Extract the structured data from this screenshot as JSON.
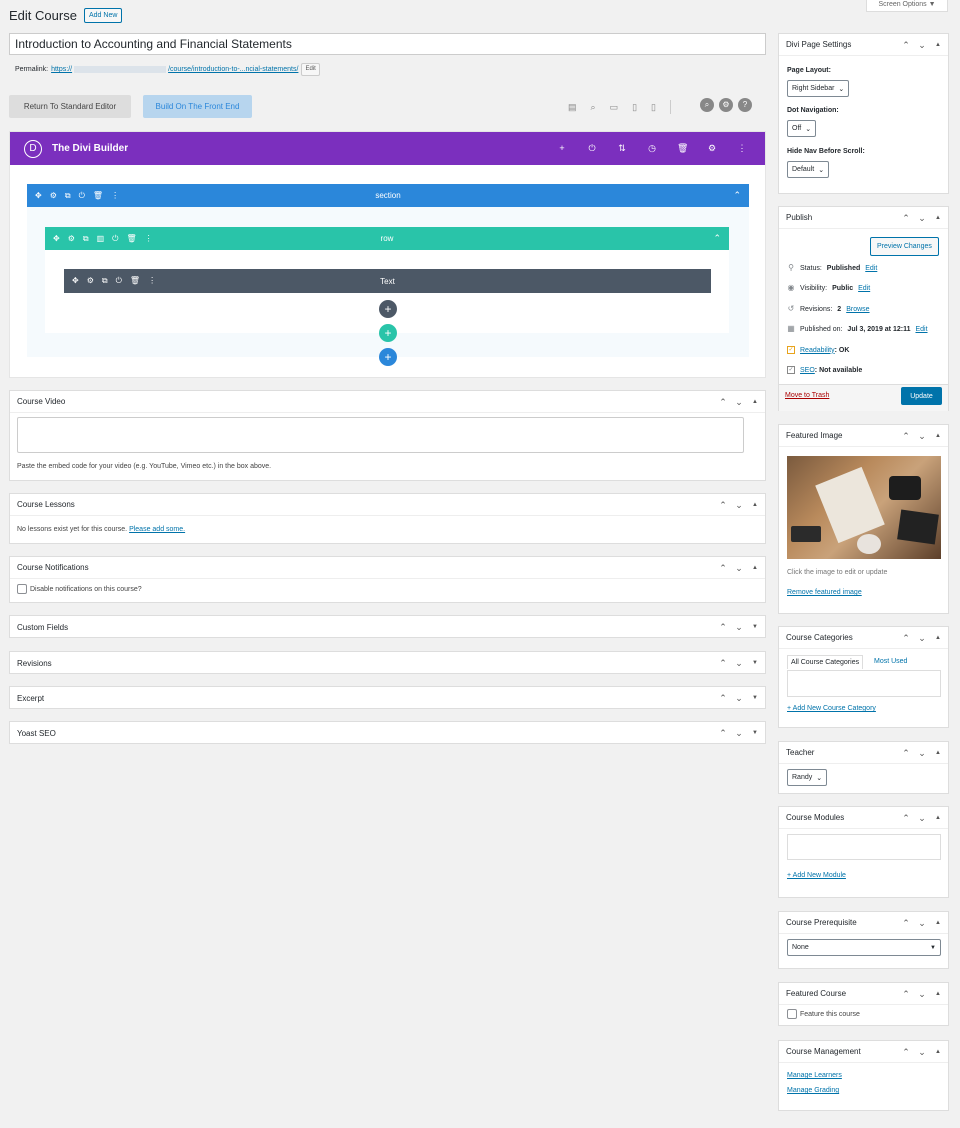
{
  "screen_options": "Screen Options ▼",
  "header": {
    "title": "Edit Course",
    "add_new": "Add New"
  },
  "post": {
    "title": "Introduction to Accounting and Financial Statements",
    "permalink_label": "Permalink:",
    "permalink_start": "https://",
    "permalink_end": "/course/introduction-to-...ncial-statements/",
    "permalink_edit": "Edit"
  },
  "editor_buttons": {
    "standard": "Return To Standard Editor",
    "frontend": "Build On The Front End"
  },
  "divi": {
    "title": "The Divi Builder",
    "logo_letter": "D",
    "section_label": "section",
    "row_label": "row",
    "module_label": "Text",
    "colors": {
      "purple": "#7b2fbe",
      "section": "#2b87da",
      "row": "#29c4a9",
      "module": "#4c5866"
    }
  },
  "boxes": {
    "course_video": {
      "title": "Course Video",
      "help": "Paste the embed code for your video (e.g. YouTube, Vimeo etc.) in the box above."
    },
    "course_lessons": {
      "title": "Course Lessons",
      "text": "No lessons exist yet for this course.",
      "link": "Please add some."
    },
    "course_notifications": {
      "title": "Course Notifications",
      "checkbox": "Disable notifications on this course?"
    },
    "custom_fields": {
      "title": "Custom Fields"
    },
    "revisions": {
      "title": "Revisions"
    },
    "excerpt": {
      "title": "Excerpt"
    },
    "yoast": {
      "title": "Yoast SEO"
    }
  },
  "sidebar": {
    "page_settings": {
      "title": "Divi Page Settings",
      "layout_label": "Page Layout:",
      "layout_value": "Right Sidebar",
      "dot_label": "Dot Navigation:",
      "dot_value": "Off",
      "hide_label": "Hide Nav Before Scroll:",
      "hide_value": "Default"
    },
    "publish": {
      "title": "Publish",
      "preview": "Preview Changes",
      "status_label": "Status:",
      "status_value": "Published",
      "status_edit": "Edit",
      "visibility_label": "Visibility:",
      "visibility_value": "Public",
      "visibility_edit": "Edit",
      "revisions_label": "Revisions:",
      "revisions_value": "2",
      "revisions_link": "Browse",
      "published_label": "Published on:",
      "published_value": "Jul 3, 2019 at 12:11",
      "published_edit": "Edit",
      "readability_link": "Readability",
      "readability_value": ": OK",
      "seo_link": "SEO",
      "seo_value": ": Not available",
      "trash": "Move to Trash",
      "update": "Update"
    },
    "featured_image": {
      "title": "Featured Image",
      "help": "Click the image to edit or update",
      "remove": "Remove featured image"
    },
    "categories": {
      "title": "Course Categories",
      "tab_all": "All Course Categories",
      "tab_most": "Most Used",
      "add": "+ Add New Course Category"
    },
    "teacher": {
      "title": "Teacher",
      "value": "Randy"
    },
    "modules": {
      "title": "Course Modules",
      "add": "+ Add New Module"
    },
    "prerequisite": {
      "title": "Course Prerequisite",
      "value": "None"
    },
    "featured_course": {
      "title": "Featured Course",
      "checkbox": "Feature this course"
    },
    "management": {
      "title": "Course Management",
      "learners": "Manage Learners",
      "grading": "Manage Grading"
    }
  }
}
